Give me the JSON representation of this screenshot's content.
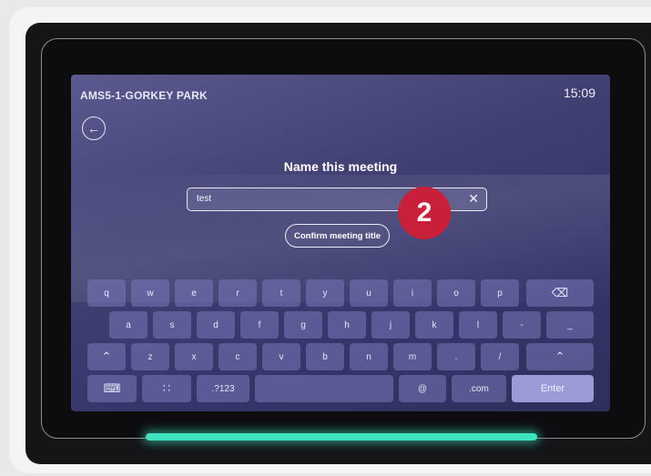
{
  "header": {
    "room_name": "AMS5-1-GORKEY PARK",
    "time": "15:09"
  },
  "dialog": {
    "heading": "Name this meeting",
    "input_value": "test",
    "confirm_label": "Confirm meeting title"
  },
  "annotation": {
    "step_number": "2",
    "color": "#c8203a"
  },
  "keyboard": {
    "row1": [
      "q",
      "w",
      "e",
      "r",
      "t",
      "y",
      "u",
      "i",
      "o",
      "p"
    ],
    "row2": [
      "a",
      "s",
      "d",
      "f",
      "g",
      "h",
      "j",
      "k",
      "l",
      "-",
      "_"
    ],
    "row3": [
      "z",
      "x",
      "c",
      "v",
      "b",
      "n",
      "m",
      ".",
      "/"
    ],
    "row4": {
      "numbers": ".?123",
      "at": "@",
      "com": ".com",
      "enter": "Enter"
    },
    "icons": [
      "backspace-icon",
      "shift-icon",
      "keyboard-icon",
      "emoji-grid-icon"
    ]
  },
  "colors": {
    "screen": "#3f3f72",
    "key": "#6e6eb0",
    "enter_key": "#9b9bd8",
    "led": "#3ee3c0"
  }
}
